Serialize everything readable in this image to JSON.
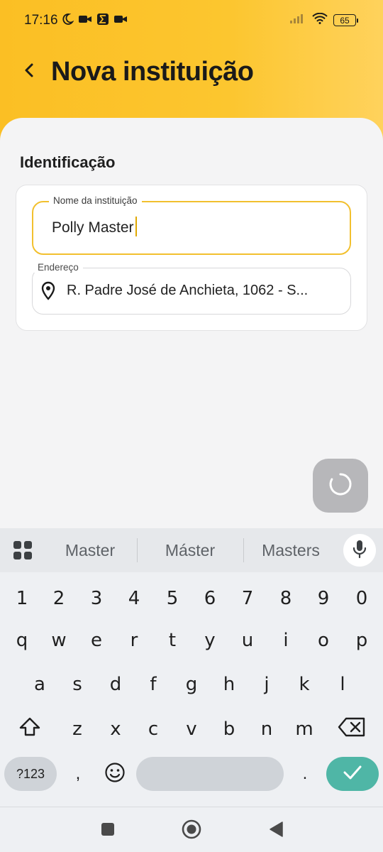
{
  "status_bar": {
    "time": "17:16",
    "battery": "65"
  },
  "header": {
    "title": "Nova instituição"
  },
  "form": {
    "section_title": "Identificação",
    "name_label": "Nome da instituição",
    "name_value": "Polly Master",
    "address_label": "Endereço",
    "address_value": "R. Padre José de Anchieta, 1062 - S..."
  },
  "keyboard": {
    "suggestions": [
      "Master",
      "Máster",
      "Masters"
    ],
    "number_row": [
      "1",
      "2",
      "3",
      "4",
      "5",
      "6",
      "7",
      "8",
      "9",
      "0"
    ],
    "row1": [
      "q",
      "w",
      "e",
      "r",
      "t",
      "y",
      "u",
      "i",
      "o",
      "p"
    ],
    "row2": [
      "a",
      "s",
      "d",
      "f",
      "g",
      "h",
      "j",
      "k",
      "l"
    ],
    "row3": [
      "z",
      "x",
      "c",
      "v",
      "b",
      "n",
      "m"
    ],
    "symbols_label": "?123",
    "comma": ",",
    "period": "."
  },
  "colors": {
    "header_accent": "#fbbf24",
    "field_focus": "#f2c02e",
    "enter_key": "#4fb6a6"
  }
}
